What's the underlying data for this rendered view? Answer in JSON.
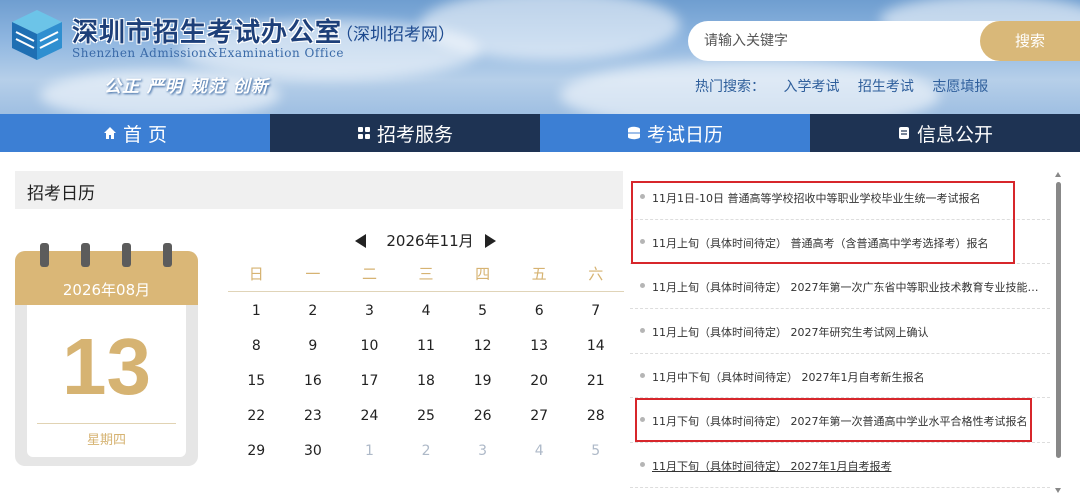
{
  "header": {
    "title": "深圳市招生考试办公室",
    "subtitle": "（深圳招考网）",
    "english": "Shenzhen Admission&Examination Office",
    "slogan": "公正 严明 规范 创新",
    "logo_icon": "cube-stack-logo-icon"
  },
  "search": {
    "placeholder": "请输入关键字",
    "button_label": "搜索",
    "hot_label": "热门搜索：",
    "hot_links": [
      "入学考试",
      "招生考试",
      "志愿填报"
    ]
  },
  "nav": {
    "items": [
      {
        "label": "首 页",
        "icon": "home-icon"
      },
      {
        "label": "招考服务",
        "icon": "grid-icon"
      },
      {
        "label": "考试日历",
        "icon": "calendar-icon"
      },
      {
        "label": "信息公开",
        "icon": "document-icon"
      }
    ]
  },
  "calendar": {
    "section_title": "招考日历",
    "today": {
      "year_month": "2026年08月",
      "day": "13",
      "weekday": "星期四"
    },
    "month_label": "2026年11月",
    "weekdays": [
      "日",
      "一",
      "二",
      "三",
      "四",
      "五",
      "六"
    ],
    "weeks": [
      [
        "1",
        "2",
        "3",
        "4",
        "5",
        "6",
        "7"
      ],
      [
        "8",
        "9",
        "10",
        "11",
        "12",
        "13",
        "14"
      ],
      [
        "15",
        "16",
        "17",
        "18",
        "19",
        "20",
        "21"
      ],
      [
        "22",
        "23",
        "24",
        "25",
        "26",
        "27",
        "28"
      ],
      [
        "29",
        "30",
        "1",
        "2",
        "3",
        "4",
        "5"
      ]
    ]
  },
  "events": [
    "11月1日-10日 普通高等学校招收中等职业学校毕业生统一考试报名",
    "11月上旬（具体时间待定） 普通高考（含普通高中学考选择考）报名",
    "11月上旬（具体时间待定） 2027年第一次广东省中等职业技术教育专业技能课...",
    "11月上旬（具体时间待定） 2027年研究生考试网上确认",
    "11月中下旬（具体时间待定） 2027年1月自考新生报名",
    "11月下旬（具体时间待定） 2027年第一次普通高中学业水平合格性考试报名",
    "11月下旬（具体时间待定） 2027年1月自考报考"
  ],
  "colors": {
    "accent_gold": "#d6b372",
    "nav_blue": "#3c7fd4",
    "nav_dark": "#1e3353",
    "highlight_red": "#d7262b"
  }
}
